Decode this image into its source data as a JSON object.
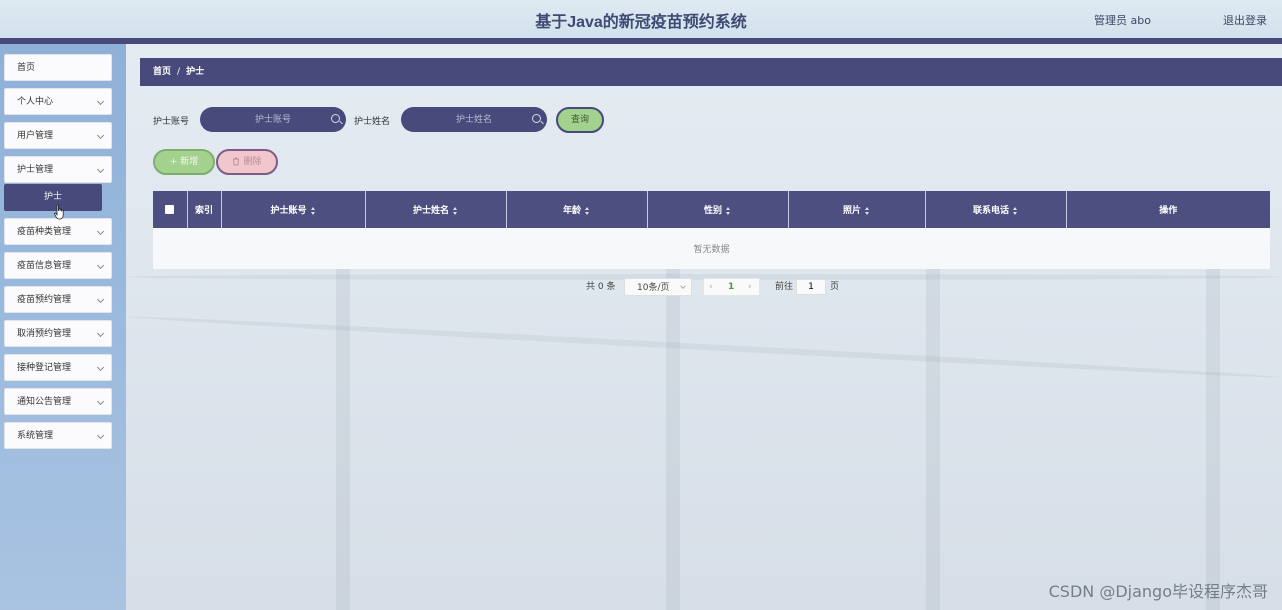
{
  "header": {
    "title": "基于Java的新冠疫苗预约系统",
    "user": "管理员 abo",
    "logout": "退出登录"
  },
  "sidebar": {
    "items": [
      {
        "label": "首页"
      },
      {
        "label": "个人中心"
      },
      {
        "label": "用户管理"
      },
      {
        "label": "护士管理"
      },
      {
        "label": "疫苗种类管理"
      },
      {
        "label": "疫苗信息管理"
      },
      {
        "label": "疫苗预约管理"
      },
      {
        "label": "取消预约管理"
      },
      {
        "label": "接种登记管理"
      },
      {
        "label": "通知公告管理"
      },
      {
        "label": "系统管理"
      }
    ],
    "submenu": {
      "label": "护士"
    }
  },
  "breadcrumb": {
    "home": "首页",
    "separator": "/",
    "current": "护士"
  },
  "search": {
    "account_label": "护士账号",
    "account_placeholder": "护士账号",
    "name_label": "护士姓名",
    "name_placeholder": "护士姓名",
    "query": "查询"
  },
  "actions": {
    "add": "+ 新增",
    "delete": "删除"
  },
  "table": {
    "columns": [
      "索引",
      "护士账号",
      "护士姓名",
      "年龄",
      "性别",
      "照片",
      "联系电话",
      "操作"
    ],
    "empty_text": "暂无数据"
  },
  "pagination": {
    "total": "共 0 条",
    "page_size": "10条/页",
    "current_page": "1",
    "goto_label": "前往",
    "goto_value": "1",
    "page_suffix": "页"
  },
  "watermark": "CSDN @Django毕设程序杰哥",
  "colors": {
    "primary": "#474a7a",
    "header_bg": "#d2e1ec",
    "sidebar_bg": "#9bbade",
    "success": "#a3d28f",
    "danger": "#f1c6cc"
  }
}
